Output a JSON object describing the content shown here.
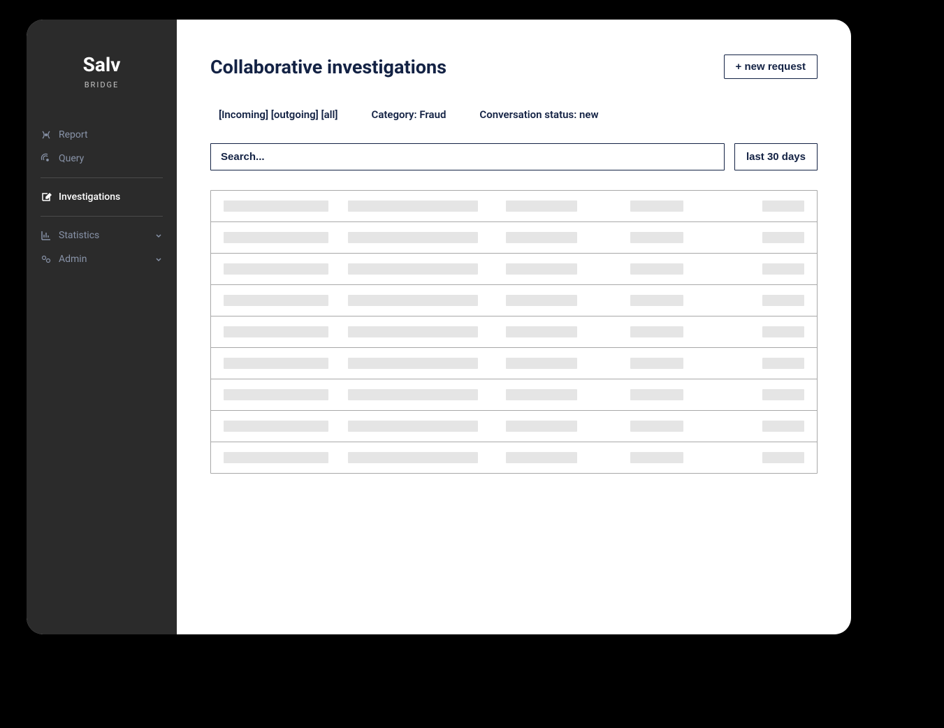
{
  "brand": {
    "name": "Salv",
    "subtitle": "BRIDGE"
  },
  "sidebar": {
    "items": [
      {
        "label": "Report"
      },
      {
        "label": "Query"
      },
      {
        "label": "Investigations"
      },
      {
        "label": "Statistics"
      },
      {
        "label": "Admin"
      }
    ]
  },
  "header": {
    "title": "Collaborative investigations",
    "new_request_label": "+ new request"
  },
  "filters": {
    "direction": "[Incoming] [outgoing] [all]",
    "category": "Category: Fraud",
    "status": "Conversation status: new"
  },
  "search": {
    "placeholder": "Search..."
  },
  "date_filter": {
    "label": "last 30 days"
  },
  "table": {
    "row_count": 9
  }
}
